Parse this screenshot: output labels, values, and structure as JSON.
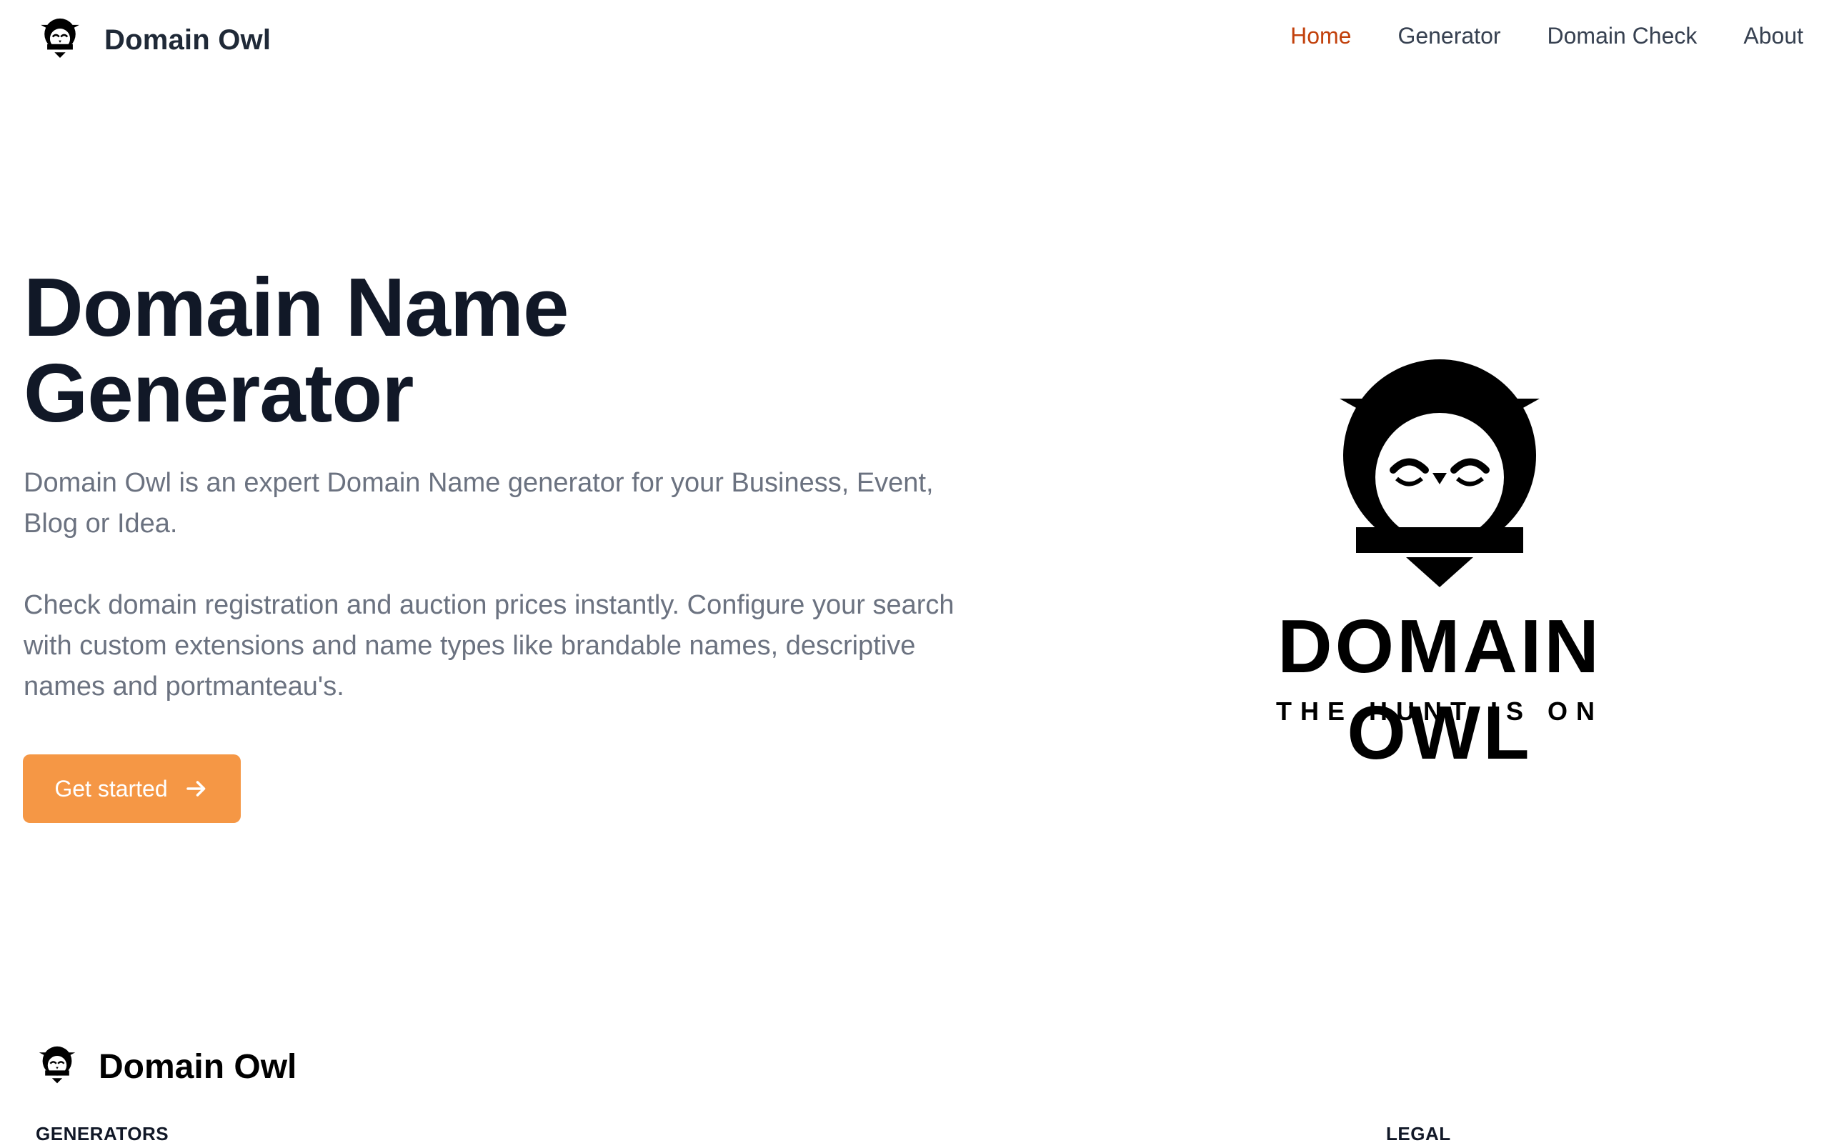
{
  "header": {
    "brand": "Domain Owl",
    "nav": [
      {
        "label": "Home",
        "active": true
      },
      {
        "label": "Generator",
        "active": false
      },
      {
        "label": "Domain Check",
        "active": false
      },
      {
        "label": "About",
        "active": false
      }
    ]
  },
  "hero": {
    "title_line1": "Domain Name",
    "title_line2": "Generator",
    "paragraph1": "Domain Owl is an expert Domain Name generator for your Business, Event, Blog or Idea.",
    "paragraph2": "Check domain registration and auction prices instantly. Configure your search with custom extensions and name types like brandable names, descriptive names and portmanteau's.",
    "cta_label": "Get started"
  },
  "logo": {
    "wordmark": "DOMAIN OWL",
    "tagline": "THE HUNT IS ON"
  },
  "footer": {
    "brand": "Domain Owl",
    "generators_heading": "GENERATORS",
    "legal_heading": "LEGAL"
  },
  "colors": {
    "accent_nav": "#c2410c",
    "cta": "#f59745",
    "text_muted": "#6b7280",
    "text_dark": "#111827"
  },
  "icons": [
    "owl-logo-icon",
    "arrow-right-icon"
  ]
}
